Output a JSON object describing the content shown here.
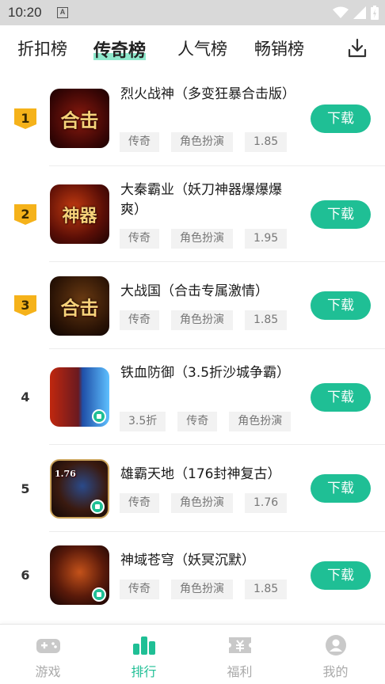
{
  "status": {
    "time": "10:20",
    "notif_letter": "A"
  },
  "tabs": [
    {
      "label": "折扣榜"
    },
    {
      "label": "传奇榜"
    },
    {
      "label": "人气榜"
    },
    {
      "label": "畅销榜"
    }
  ],
  "games": [
    {
      "rank": "1",
      "title": "烈火战神（多变狂暴合击版）",
      "tags": [
        "传奇",
        "角色扮演",
        "1.85"
      ],
      "button": "下载",
      "icon_text": "合击"
    },
    {
      "rank": "2",
      "title": "大秦霸业（妖刀神器爆爆爆爽）",
      "tags": [
        "传奇",
        "角色扮演",
        "1.95"
      ],
      "button": "下载",
      "icon_text": "神器"
    },
    {
      "rank": "3",
      "title": "大战国（合击专属激情）",
      "tags": [
        "传奇",
        "角色扮演",
        "1.85"
      ],
      "button": "下载",
      "icon_text": "合击"
    },
    {
      "rank": "4",
      "title": "铁血防御（3.5折沙城争霸）",
      "tags": [
        "3.5折",
        "传奇",
        "角色扮演"
      ],
      "button": "下载",
      "icon_text": ""
    },
    {
      "rank": "5",
      "title": "雄霸天地（176封神复古）",
      "tags": [
        "传奇",
        "角色扮演",
        "1.76"
      ],
      "button": "下载",
      "icon_text": "1.76"
    },
    {
      "rank": "6",
      "title": "神域苍穹（妖冥沉默）",
      "tags": [
        "传奇",
        "角色扮演",
        "1.85"
      ],
      "button": "下载",
      "icon_text": ""
    }
  ],
  "nav": [
    {
      "label": "游戏",
      "icon": "gamepad-icon"
    },
    {
      "label": "排行",
      "icon": "ranking-icon"
    },
    {
      "label": "福利",
      "icon": "ticket-icon"
    },
    {
      "label": "我的",
      "icon": "user-icon"
    }
  ],
  "colors": {
    "accent": "#1fbf95",
    "badge": "#f5b21a",
    "tab_highlight": "#8fe8cc"
  }
}
